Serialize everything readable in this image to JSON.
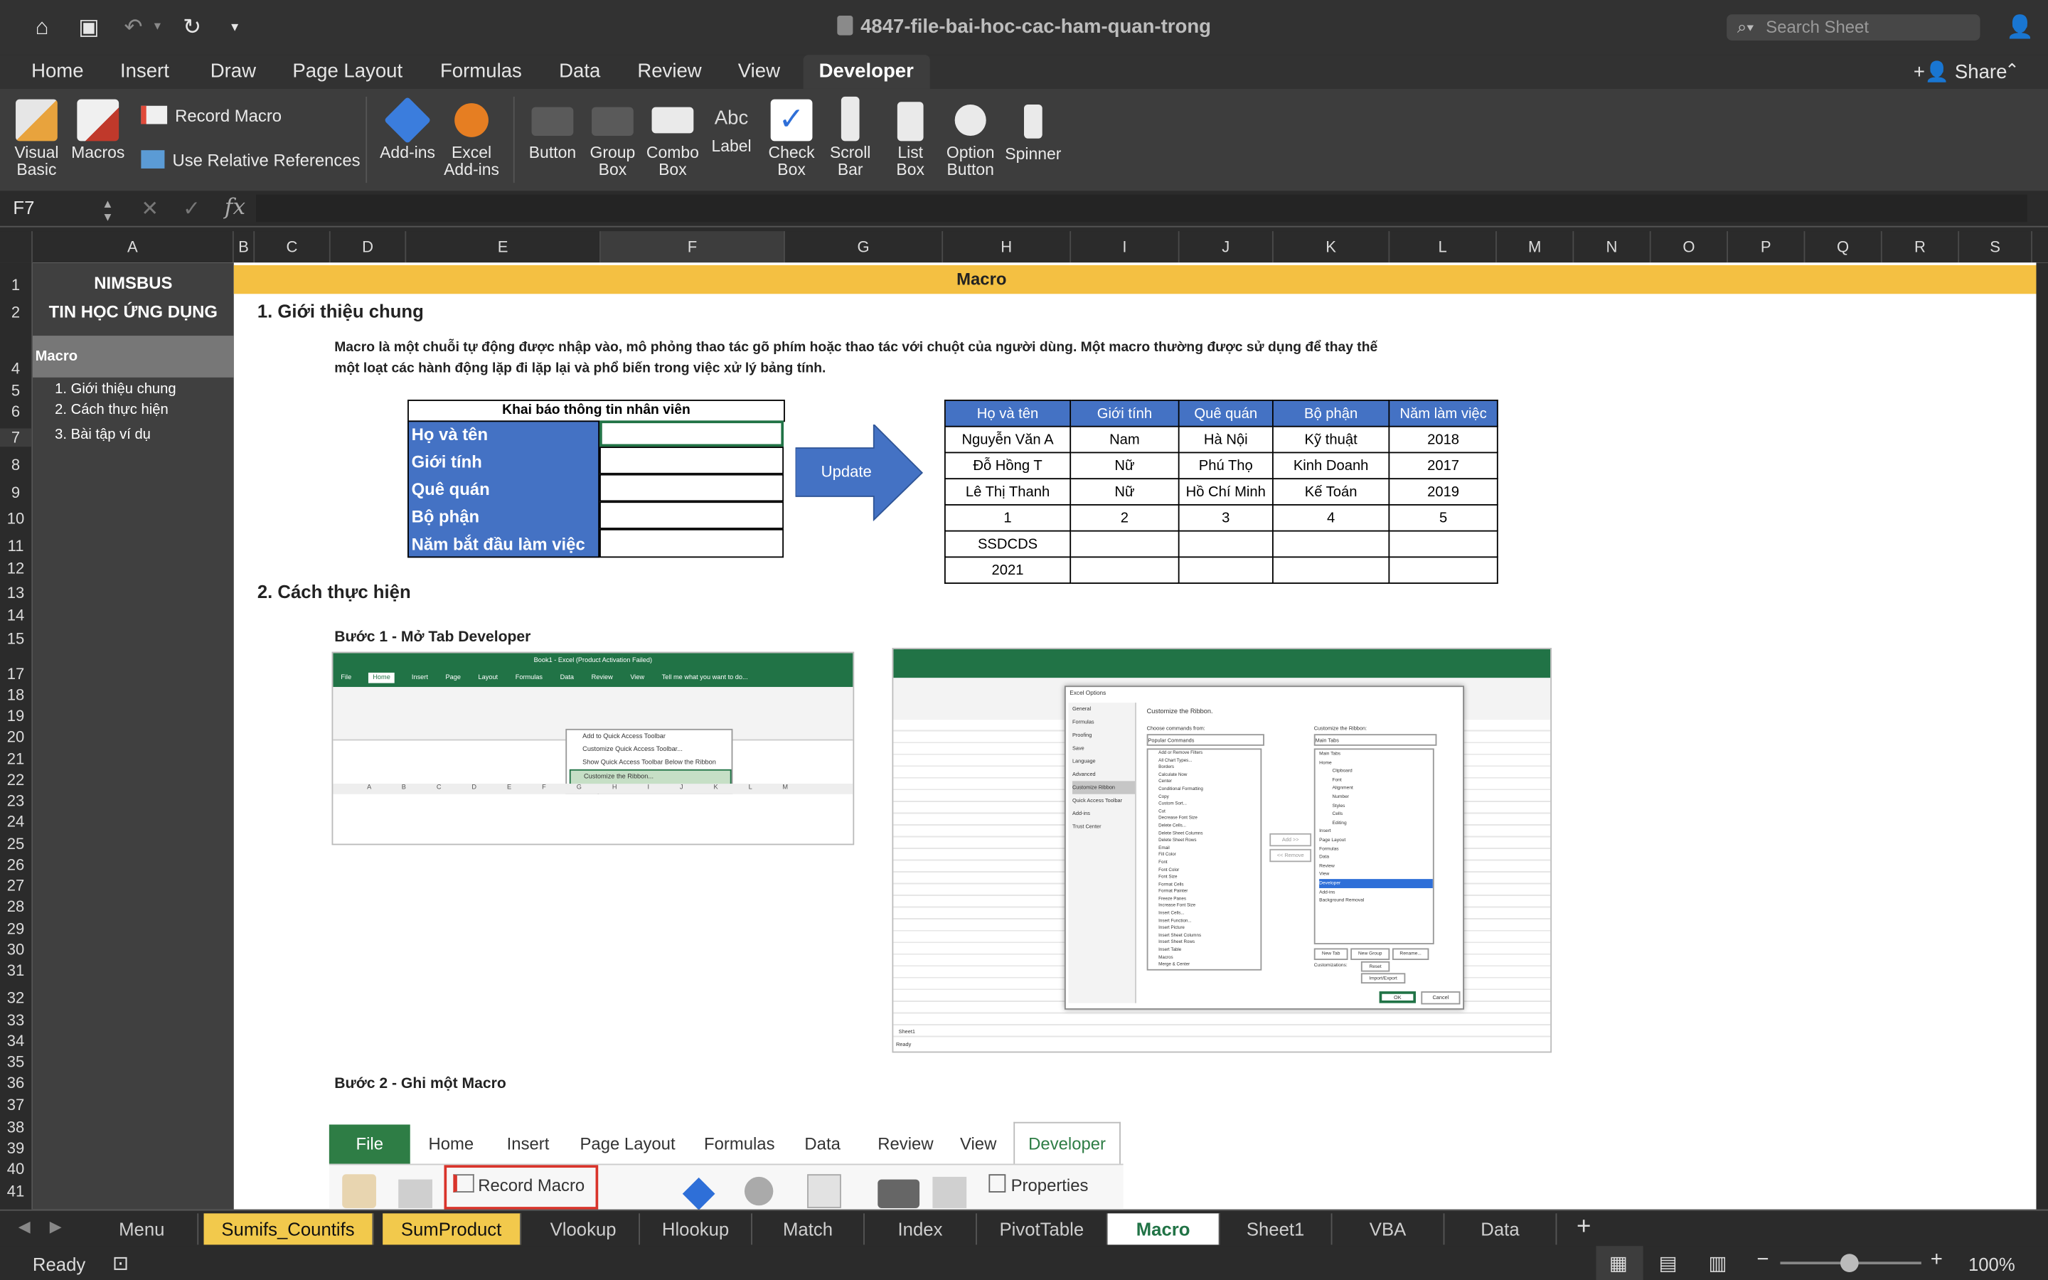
{
  "window": {
    "title": "4847-file-bai-hoc-cac-ham-quan-trong",
    "search_placeholder": "Search Sheet",
    "share_label": "Share"
  },
  "menu_tabs": [
    "Home",
    "Insert",
    "Draw",
    "Page Layout",
    "Formulas",
    "Data",
    "Review",
    "View",
    "Developer"
  ],
  "active_tab": "Developer",
  "ribbon": {
    "visual_basic": "Visual Basic",
    "macros": "Macros",
    "record_macro": "Record Macro",
    "use_relative": "Use Relative References",
    "add_ins": "Add-ins",
    "excel_add_ins": "Excel Add-ins",
    "button": "Button",
    "group_box": "Group Box",
    "combo_box": "Combo Box",
    "label": "Label",
    "check_box": "Check Box",
    "scroll_bar": "Scroll Bar",
    "list_box": "List Box",
    "option_button": "Option Button",
    "spinner": "Spinner"
  },
  "formula_bar": {
    "name_box": "F7",
    "fx": "fx",
    "content": ""
  },
  "columns": [
    "A",
    "B",
    "C",
    "D",
    "E",
    "F",
    "G",
    "H",
    "I",
    "J",
    "K",
    "L",
    "M",
    "N",
    "O",
    "P",
    "Q",
    "R",
    "S"
  ],
  "rows": [
    "1",
    "2",
    "4",
    "5",
    "6",
    "7",
    "8",
    "9",
    "10",
    "11",
    "12",
    "13",
    "14",
    "15",
    "17",
    "18",
    "19",
    "20",
    "21",
    "22",
    "23",
    "24",
    "25",
    "26",
    "27",
    "28",
    "29",
    "30",
    "31",
    "32",
    "33",
    "34",
    "35",
    "36",
    "37",
    "38",
    "39",
    "40",
    "41"
  ],
  "sheet": {
    "brand": "NIMSBUS",
    "course": "TIN HỌC ỨNG DỤNG",
    "nav_title": "Macro",
    "nav_items": [
      "1. Giới thiệu chung",
      "2. Cách thực hiện",
      "3. Bài tập ví dụ"
    ],
    "banner": "Macro",
    "section1": "1. Giới thiệu chung",
    "intro1": "Macro là một chuỗi tự động  được nhập vào, mô phỏng thao tác gõ phím hoặc thao tác với chuột của người dùng. Một macro thường được sử dụng để thay thế",
    "intro2": "một loạt các hành động lặp đi lặp lại và phổ biến trong việc xử lý bảng tính.",
    "form_title": "Khai báo thông tin nhân viên",
    "form_labels": [
      "Họ và tên",
      "Giới tính",
      "Quê quán",
      "Bộ phận",
      "Năm bắt đầu làm việc"
    ],
    "update": "Update",
    "table_headers": [
      "Họ và tên",
      "Giới tính",
      "Quê quán",
      "Bộ phận",
      "Năm làm việc"
    ],
    "table_rows": [
      [
        "Nguyễn Văn A",
        "Nam",
        "Hà Nội",
        "Kỹ thuật",
        "2018"
      ],
      [
        "Đỗ Hồng T",
        "Nữ",
        "Phú Thọ",
        "Kinh Doanh",
        "2017"
      ],
      [
        "Lê Thị Thanh",
        "Nữ",
        "Hồ Chí Minh",
        "Kế Toán",
        "2019"
      ],
      [
        "1",
        "2",
        "3",
        "4",
        "5"
      ],
      [
        "SSDCDS",
        "",
        "",
        "",
        ""
      ],
      [
        "2021",
        "",
        "",
        "",
        ""
      ]
    ],
    "section2": "2. Cách thực hiện",
    "step1": "Bước 1 -  Mở Tab Developer",
    "step2": "Bước 2 -  Ghi một Macro",
    "shot1": {
      "title": "Book1 - Excel (Product Activation Failed)",
      "tabs": [
        "File",
        "Home",
        "Insert",
        "Page Layout",
        "Formulas",
        "Data",
        "Review",
        "View"
      ],
      "tell": "Tell me what you want to do...",
      "menu": [
        "Add to Quick Access Toolbar",
        "Customize Quick Access Toolbar...",
        "Show Quick Access Toolbar Below the Ribbon",
        "Customize the Ribbon...",
        "Collapse the Ribbon"
      ],
      "cols": [
        "A",
        "B",
        "C",
        "D",
        "E",
        "F",
        "G",
        "H",
        "I",
        "J",
        "K",
        "L",
        "M"
      ]
    },
    "shot2": {
      "dialog_title": "Excel Options",
      "left_items": [
        "General",
        "Formulas",
        "Proofing",
        "Save",
        "Language",
        "Advanced",
        "Customize Ribbon",
        "Quick Access Toolbar",
        "Add-ins",
        "Trust Center"
      ],
      "heading": "Customize the Ribbon.",
      "choose_label": "Choose commands from:",
      "choose_value": "Popular Commands",
      "customize_label": "Customize the Ribbon:",
      "customize_value": "Main Tabs",
      "commands": [
        "Add or Remove Filters",
        "All Chart Types...",
        "Borders",
        "Calculate Now",
        "Center",
        "Conditional Formatting",
        "Copy",
        "Custom Sort...",
        "Cut",
        "Decrease Font Size",
        "Delete Cells...",
        "Delete Sheet Columns",
        "Delete Sheet Rows",
        "Email",
        "Fill Color",
        "Font",
        "Font Color",
        "Font Size",
        "Format Cells",
        "Format Painter",
        "Freeze Panes",
        "Increase Font Size",
        "Insert Cells...",
        "Insert Function...",
        "Insert Picture",
        "Insert Sheet Columns",
        "Insert Sheet Rows",
        "Insert Table",
        "Macros",
        "Merge & Center"
      ],
      "tabs_tree": [
        "Main Tabs",
        "Home",
        "Clipboard",
        "Font",
        "Alignment",
        "Number",
        "Styles",
        "Cells",
        "Editing",
        "Insert",
        "Page Layout",
        "Formulas",
        "Data",
        "Review",
        "View",
        "Developer",
        "Add-ins",
        "Background Removal"
      ],
      "buttons": [
        "New Tab",
        "New Group",
        "Rename...",
        "Reset",
        "Import/Export",
        "OK",
        "Cancel"
      ],
      "add": "Add >>",
      "remove": "<< Remove",
      "customizations": "Customizations:",
      "sheet_tab": "Sheet1",
      "ready": "Ready"
    },
    "shot3": {
      "tabs": [
        "File",
        "Home",
        "Insert",
        "Page Layout",
        "Formulas",
        "Data",
        "Review",
        "View",
        "Developer"
      ],
      "record": "Record Macro",
      "properties": "Properties"
    }
  },
  "sheet_tabs": [
    "Menu",
    "Sumifs_Countifs",
    "SumProduct",
    "Vlookup",
    "Hlookup",
    "Match",
    "Index",
    "PivotTable",
    "Macro",
    "Sheet1",
    "VBA",
    "Data"
  ],
  "active_sheet": "Macro",
  "status": {
    "ready": "Ready",
    "zoom": "100%"
  },
  "colors": {
    "banner": "#f4c042",
    "form_label_bg": "#4472c4",
    "table_header_bg": "#4472c4",
    "arrow": "#4472c4",
    "excel_green": "#217346"
  }
}
